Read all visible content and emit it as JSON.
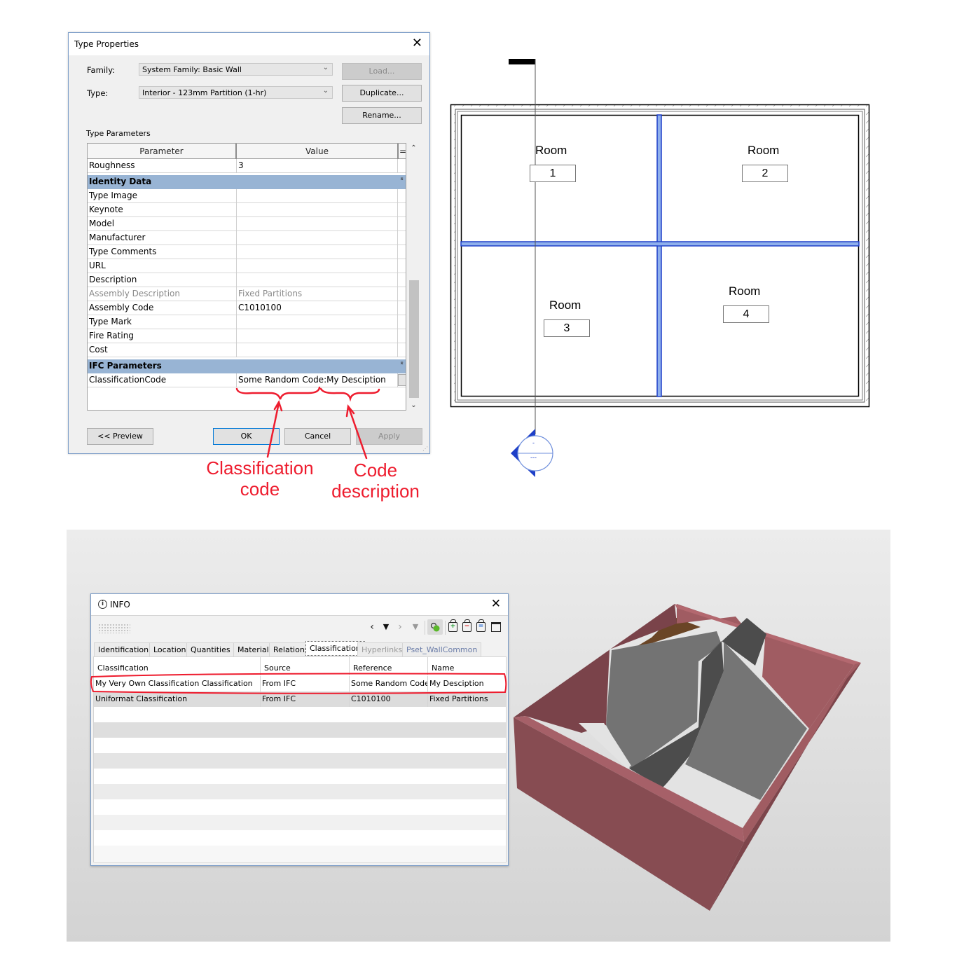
{
  "type_properties": {
    "title": "Type Properties",
    "family_label": "Family:",
    "family_value": "System Family: Basic Wall",
    "type_label": "Type:",
    "type_value": "Interior - 123mm Partition (1-hr)",
    "load_button": "Load...",
    "duplicate_button": "Duplicate...",
    "rename_button": "Rename...",
    "section_label": "Type Parameters",
    "grid_headers": {
      "parameter": "Parameter",
      "value": "Value",
      "sort": "="
    },
    "rows": [
      {
        "kind": "row",
        "param": "Roughness",
        "value": "3"
      },
      {
        "kind": "group",
        "param": "Identity Data"
      },
      {
        "kind": "row",
        "param": "Type Image",
        "value": ""
      },
      {
        "kind": "row",
        "param": "Keynote",
        "value": ""
      },
      {
        "kind": "row",
        "param": "Model",
        "value": ""
      },
      {
        "kind": "row",
        "param": "Manufacturer",
        "value": ""
      },
      {
        "kind": "row",
        "param": "Type Comments",
        "value": ""
      },
      {
        "kind": "row",
        "param": "URL",
        "value": ""
      },
      {
        "kind": "row",
        "param": "Description",
        "value": ""
      },
      {
        "kind": "row",
        "param": "Assembly Description",
        "value": "Fixed Partitions",
        "readonly": true
      },
      {
        "kind": "row",
        "param": "Assembly Code",
        "value": "C1010100"
      },
      {
        "kind": "row",
        "param": "Type Mark",
        "value": ""
      },
      {
        "kind": "row",
        "param": "Fire Rating",
        "value": ""
      },
      {
        "kind": "row",
        "param": "Cost",
        "value": ""
      },
      {
        "kind": "group",
        "param": "IFC Parameters"
      },
      {
        "kind": "row",
        "param": "ClassificationCode",
        "value": "Some Random Code:My Desciption"
      }
    ],
    "preview_button": "<< Preview",
    "ok_button": "OK",
    "cancel_button": "Cancel",
    "apply_button": "Apply"
  },
  "annotations": {
    "classification_code": "Classification\ncode",
    "code_description": "Code\ndescription",
    "color": "#ee1c2e"
  },
  "floor_plan": {
    "rooms": [
      {
        "name": "Room",
        "number": "1"
      },
      {
        "name": "Room",
        "number": "2"
      },
      {
        "name": "Room",
        "number": "3"
      },
      {
        "name": "Room",
        "number": "4"
      }
    ],
    "section_marker": {
      "top": "-",
      "bottom": "---"
    },
    "highlight_color": "#1e3fc8"
  },
  "info_panel": {
    "title": "INFO",
    "toolbar": [
      "back-icon",
      "history-dropdown-icon",
      "forward-icon",
      "forward-dropdown-icon",
      "gear-toggle-icon",
      "add-pset-icon",
      "remove-pset-icon",
      "edit-pset-icon",
      "window-icon"
    ],
    "tabs": [
      {
        "label": "Identification",
        "state": "normal"
      },
      {
        "label": "Location",
        "state": "normal"
      },
      {
        "label": "Quantities",
        "state": "normal"
      },
      {
        "label": "Material",
        "state": "normal"
      },
      {
        "label": "Relations",
        "state": "normal"
      },
      {
        "label": "Classification",
        "state": "active"
      },
      {
        "label": "Hyperlinks",
        "state": "dim"
      },
      {
        "label": "Pset_WallCommon",
        "state": "pset"
      }
    ],
    "columns": [
      "Classification",
      "Source",
      "Reference",
      "Name"
    ],
    "rows": [
      [
        "My Very Own Classification Classification",
        "From IFC",
        "Some Random Code",
        "My Desciption"
      ],
      [
        "Uniformat Classification",
        "From IFC",
        "C1010100",
        "Fixed Partitions"
      ]
    ]
  },
  "model_view": {
    "wall_color": "#8a4c52",
    "partition_color": "#737373"
  }
}
